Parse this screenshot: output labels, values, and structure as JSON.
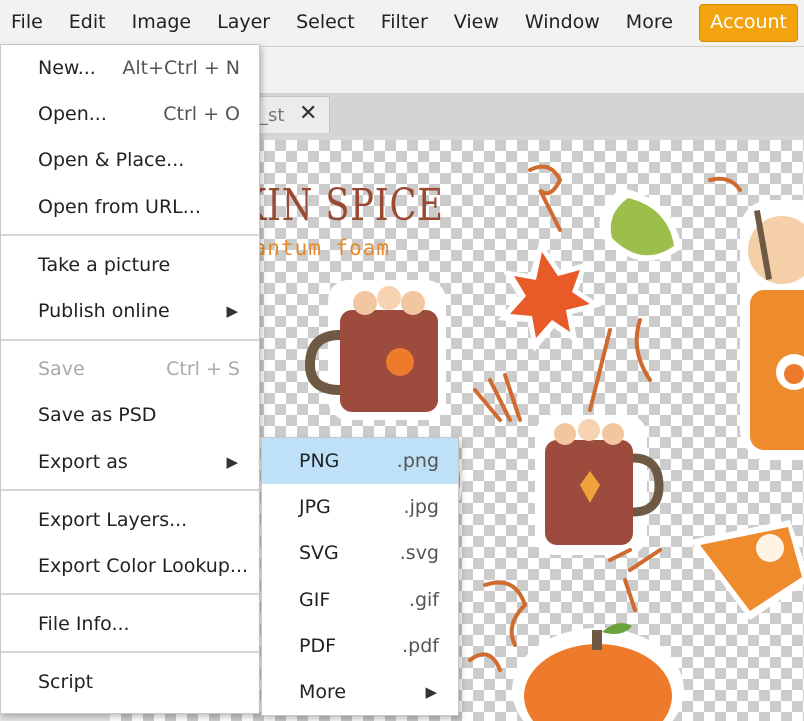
{
  "menubar": {
    "items": [
      "File",
      "Edit",
      "Image",
      "Layer",
      "Select",
      "Filter",
      "View",
      "Window",
      "More"
    ],
    "account_label": "Account",
    "accent_color": "#f3a30e"
  },
  "document_tab": {
    "title": "_st",
    "close_glyph": "✕"
  },
  "canvas": {
    "title": "KIN SPICE",
    "subtitle": "uantum foam"
  },
  "file_menu": {
    "new": {
      "label": "New...",
      "shortcut": "Alt+Ctrl + N"
    },
    "open": {
      "label": "Open...",
      "shortcut": "Ctrl + O"
    },
    "open_place": {
      "label": "Open & Place..."
    },
    "open_url": {
      "label": "Open from URL..."
    },
    "take_picture": {
      "label": "Take a picture"
    },
    "publish_online": {
      "label": "Publish online",
      "arrow": "▶"
    },
    "save": {
      "label": "Save",
      "shortcut": "Ctrl + S",
      "disabled": true
    },
    "save_psd": {
      "label": "Save as PSD"
    },
    "export_as": {
      "label": "Export as",
      "arrow": "▶"
    },
    "export_layers": {
      "label": "Export Layers..."
    },
    "export_color_lookup": {
      "label": "Export Color Lookup..."
    },
    "file_info": {
      "label": "File Info..."
    },
    "script": {
      "label": "Script"
    }
  },
  "export_submenu": {
    "items": [
      {
        "label": "PNG",
        "ext": ".png",
        "active": true
      },
      {
        "label": "JPG",
        "ext": ".jpg"
      },
      {
        "label": "SVG",
        "ext": ".svg"
      },
      {
        "label": "GIF",
        "ext": ".gif"
      },
      {
        "label": "PDF",
        "ext": ".pdf"
      }
    ],
    "more": {
      "label": "More",
      "arrow": "▶"
    }
  }
}
